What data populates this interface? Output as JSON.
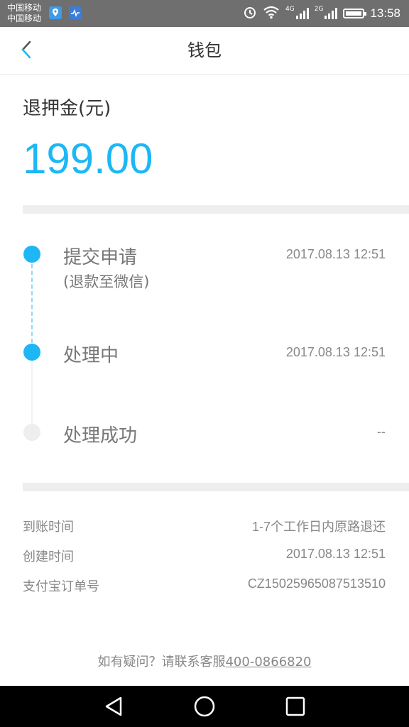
{
  "status_bar": {
    "carrier_1": "中国移动",
    "carrier_2": "中国移动",
    "network_1": "4G",
    "network_2": "2G",
    "time": "13:58",
    "icons": [
      "location-app-icon",
      "health-app-icon",
      "alarm-icon",
      "wifi-icon",
      "signal-icon",
      "signal-icon",
      "battery-icon"
    ]
  },
  "header": {
    "title": "钱包",
    "back_icon": "chevron-left-icon"
  },
  "refund": {
    "label": "退押金(元)",
    "amount": "199.00"
  },
  "timeline": [
    {
      "title": "提交申请",
      "subtitle": "(退款至微信)",
      "time": "2017.08.13 12:51",
      "state": "done"
    },
    {
      "title": "处理中",
      "subtitle": "",
      "time": "2017.08.13 12:51",
      "state": "done"
    },
    {
      "title": "处理成功",
      "subtitle": "",
      "time": "--",
      "state": "pending"
    }
  ],
  "details": [
    {
      "label": "到账时间",
      "value": "1-7个工作日内原路退还"
    },
    {
      "label": "创建时间",
      "value": "2017.08.13 12:51"
    },
    {
      "label": "支付宝订单号",
      "value": "CZ15025965087513510"
    }
  ],
  "footer": {
    "text": "如有疑问？请联系客服",
    "phone": "400-0866820"
  },
  "colors": {
    "accent": "#1db7f5",
    "status_bar": "#6f6f6f",
    "divider": "#eeeeee"
  }
}
